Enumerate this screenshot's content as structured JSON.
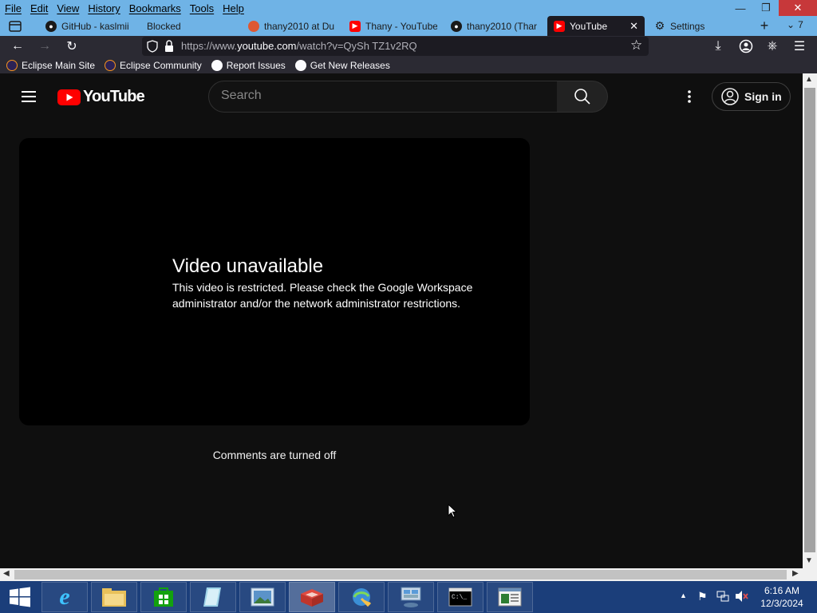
{
  "menubar": {
    "items": [
      "File",
      "Edit",
      "View",
      "History",
      "Bookmarks",
      "Tools",
      "Help"
    ]
  },
  "tabs": [
    {
      "label": "GitHub - kaslmii",
      "icon": "github-icon"
    },
    {
      "label": "Blocked",
      "icon": ""
    },
    {
      "label": "thany2010 at Du",
      "icon": "duckduckgo-icon"
    },
    {
      "label": "Thany - YouTube",
      "icon": "youtube-icon"
    },
    {
      "label": "thany2010 (Thar",
      "icon": "github-icon"
    },
    {
      "label": "YouTube",
      "icon": "youtube-icon",
      "active": true
    },
    {
      "label": "Settings",
      "icon": "gear-icon"
    }
  ],
  "tab_overflow_count": "7",
  "urlbar": {
    "prefix": "https://www.",
    "domain": "youtube.com",
    "path": "/watch?v=QySh TZ1v2RQ"
  },
  "bookmarks": [
    {
      "label": "Eclipse Main Site"
    },
    {
      "label": "Eclipse Community"
    },
    {
      "label": "Report Issues"
    },
    {
      "label": "Get New Releases"
    }
  ],
  "youtube": {
    "logo_text": "YouTube",
    "search_placeholder": "Search",
    "signin_label": "Sign in",
    "error_title": "Video unavailable",
    "error_message": "This video is restricted. Please check the Google Workspace administrator and/or the network administrator restrictions.",
    "comments_status": "Comments are turned off"
  },
  "taskbar": {
    "time": "6:16 AM",
    "date": "12/3/2024"
  },
  "colors": {
    "youtube_red": "#ff0000",
    "page_bg": "#0f0f0f",
    "chrome_frame": "#6fb3e6",
    "taskbar": "#1b3e7a"
  }
}
